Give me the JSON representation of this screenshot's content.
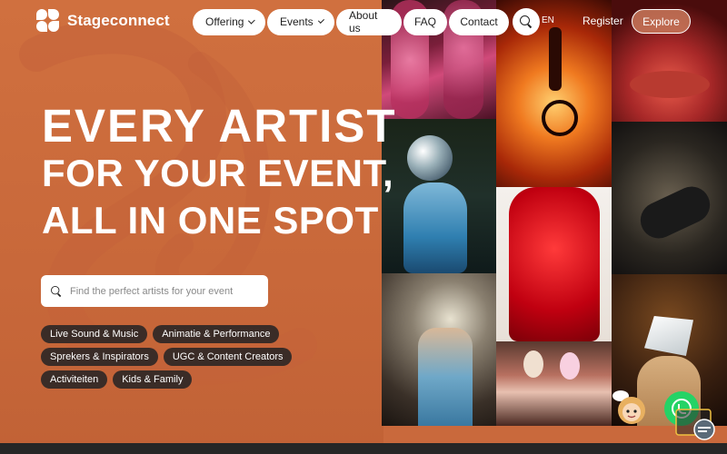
{
  "brand": {
    "name": "Stageconnect"
  },
  "nav": {
    "items": [
      {
        "label": "Offering",
        "has_dropdown": true
      },
      {
        "label": "Events",
        "has_dropdown": true
      },
      {
        "label": "About us",
        "has_dropdown": false
      },
      {
        "label": "FAQ",
        "has_dropdown": false
      },
      {
        "label": "Contact",
        "has_dropdown": false
      }
    ],
    "language": "EN",
    "register_label": "Register",
    "explore_label": "Explore"
  },
  "hero": {
    "line1": "EVERY ARTIST",
    "line2": "FOR YOUR EVENT,",
    "line3": "ALL IN ONE SPOT"
  },
  "search": {
    "placeholder": "Find the perfect artists for your event",
    "value": ""
  },
  "categories": [
    "Live Sound & Music",
    "Animatie & Performance",
    "Sprekers & Inspirators",
    "UGC & Content Creators",
    "Activiteiten",
    "Kids & Family"
  ],
  "colors": {
    "hero_orange": "#c9693c",
    "chip_dark": "#3a2c27",
    "whatsapp_green": "#25d366",
    "footer_dark": "#262626"
  },
  "icons": {
    "search": "search-icon",
    "dropdown": "chevron-down-icon",
    "whatsapp": "whatsapp-icon",
    "chat": "chat-widget-icon"
  }
}
